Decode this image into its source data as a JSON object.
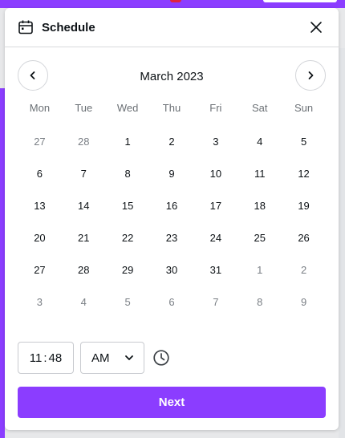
{
  "header": {
    "title": "Schedule"
  },
  "calendar": {
    "month_label": "March 2023",
    "weekdays": [
      "Mon",
      "Tue",
      "Wed",
      "Thu",
      "Fri",
      "Sat",
      "Sun"
    ],
    "weeks": [
      [
        {
          "d": "27",
          "muted": true
        },
        {
          "d": "28",
          "muted": true
        },
        {
          "d": "1",
          "muted": false
        },
        {
          "d": "2",
          "muted": false
        },
        {
          "d": "3",
          "muted": false
        },
        {
          "d": "4",
          "muted": false
        },
        {
          "d": "5",
          "muted": false
        }
      ],
      [
        {
          "d": "6",
          "muted": false
        },
        {
          "d": "7",
          "muted": false
        },
        {
          "d": "8",
          "muted": false
        },
        {
          "d": "9",
          "muted": false
        },
        {
          "d": "10",
          "muted": false
        },
        {
          "d": "11",
          "muted": false
        },
        {
          "d": "12",
          "muted": false
        }
      ],
      [
        {
          "d": "13",
          "muted": false
        },
        {
          "d": "14",
          "muted": false
        },
        {
          "d": "15",
          "muted": false
        },
        {
          "d": "16",
          "muted": false
        },
        {
          "d": "17",
          "muted": false
        },
        {
          "d": "18",
          "muted": false
        },
        {
          "d": "19",
          "muted": false
        }
      ],
      [
        {
          "d": "20",
          "muted": false
        },
        {
          "d": "21",
          "muted": false
        },
        {
          "d": "22",
          "muted": false
        },
        {
          "d": "23",
          "muted": false
        },
        {
          "d": "24",
          "muted": false
        },
        {
          "d": "25",
          "muted": false
        },
        {
          "d": "26",
          "muted": false
        }
      ],
      [
        {
          "d": "27",
          "muted": false
        },
        {
          "d": "28",
          "muted": false
        },
        {
          "d": "29",
          "muted": false
        },
        {
          "d": "30",
          "muted": false
        },
        {
          "d": "31",
          "muted": false
        },
        {
          "d": "1",
          "muted": true
        },
        {
          "d": "2",
          "muted": true
        }
      ],
      [
        {
          "d": "3",
          "muted": true
        },
        {
          "d": "4",
          "muted": true
        },
        {
          "d": "5",
          "muted": true
        },
        {
          "d": "6",
          "muted": true
        },
        {
          "d": "7",
          "muted": true
        },
        {
          "d": "8",
          "muted": true
        },
        {
          "d": "9",
          "muted": true
        }
      ]
    ]
  },
  "time": {
    "hour": "11",
    "minute": "48",
    "period": "AM"
  },
  "actions": {
    "next_label": "Next"
  },
  "icons": {
    "calendar": "calendar-icon",
    "close": "close-icon",
    "prev": "chevron-left-icon",
    "next": "chevron-right-icon",
    "dropdown": "chevron-down-icon",
    "clock": "clock-icon"
  },
  "colors": {
    "accent": "#8b3dff",
    "text": "#0d1216",
    "muted_text": "#7a7f85"
  }
}
